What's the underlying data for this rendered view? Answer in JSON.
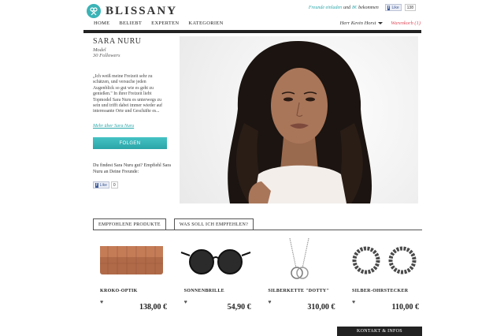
{
  "brand": {
    "name": "BLISSANY",
    "logo_icon": "scissors-key-icon",
    "accent": "#3ab3b6"
  },
  "top": {
    "invite": "Freunde einladen",
    "und": "und",
    "amount": "8€",
    "bekommen": "bekommen",
    "fb_like": "Like",
    "fb_count": "138"
  },
  "nav": {
    "items": [
      "HOME",
      "BELIEBT",
      "EXPERTEN",
      "KATEGORIEN"
    ]
  },
  "user": {
    "name": "Herr Kevin Horst",
    "cart": "Warenkorb (1)"
  },
  "profile": {
    "name": "SARA NURU",
    "role": "Model",
    "followers": "30 Followers",
    "bio": "„Ich weiß meine Freizeit sehr zu schätzen, und versuche jeden Augenblick so gut wie es geht zu genießen.\" In ihrer Freizeit liebt Topmodel Sara Nuru es unterwegs zu sein und trifft dabei immer wieder auf interessante Orte und Geschäfte es...",
    "more_link": "Mehr über Sara Nuru",
    "follow_button": "FOLGEN",
    "recommend_text": "Du findest Sara Nuru gut? Empfiehl Sara Nuru an Deine Freunde:",
    "fb_like": "Like",
    "fb_count": "0"
  },
  "tabs": [
    "EMPFOHLENE PRODUKTE",
    "WAS SOLL ICH EMPFEHLEN?"
  ],
  "products": [
    {
      "name": "KROKO-OPTIK",
      "price": "138,00 €"
    },
    {
      "name": "SONNENBRILLE",
      "price": "54,90 €"
    },
    {
      "name": "SILBERKETTE \"DOTTY\"",
      "price": "310,00 €"
    },
    {
      "name": "SILBER-OHRSTECKER",
      "price": "110,00 €"
    }
  ],
  "footer": {
    "contact": "KONTAKT & INFOS"
  }
}
